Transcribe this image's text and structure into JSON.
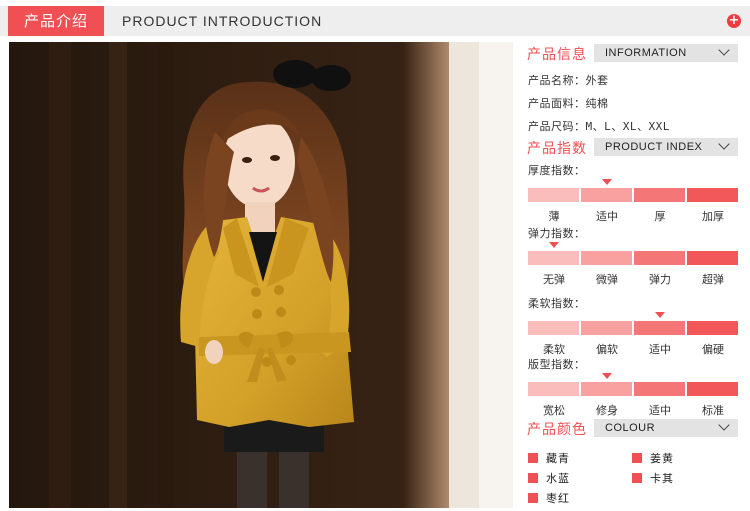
{
  "header": {
    "cn_title": "产品介绍",
    "en_title": "PRODUCT INTRODUCTION",
    "plus_icon": "plus-circle-icon"
  },
  "photo": {
    "alt": "model wearing mustard yellow double-breasted trench coat with belt"
  },
  "info": {
    "cn": "产品信息",
    "en": "INFORMATION",
    "lines": [
      {
        "label": "产品名称：",
        "value": "外套"
      },
      {
        "label": "产品面料：",
        "value": "纯棉"
      },
      {
        "label": "产品尺码：",
        "value": "M、L、XL、XXL"
      }
    ]
  },
  "index": {
    "cn": "产品指数",
    "en": "PRODUCT INDEX",
    "scale_colors": [
      "#fbbcbc",
      "#f9a0a0",
      "#f57676",
      "#f2585a"
    ],
    "arrow_color": "#f04f53",
    "rows": [
      {
        "label": "厚度指数：",
        "options": [
          "薄",
          "适中",
          "厚",
          "加厚"
        ],
        "selected": 1
      },
      {
        "label": "弹力指数：",
        "options": [
          "无弹",
          "微弹",
          "弹力",
          "超弹"
        ],
        "selected": 0
      },
      {
        "label": "柔软指数：",
        "options": [
          "柔软",
          "偏软",
          "适中",
          "偏硬"
        ],
        "selected": 2
      },
      {
        "label": "版型指数：",
        "options": [
          "宽松",
          "修身",
          "适中",
          "标准"
        ],
        "selected": 1
      }
    ]
  },
  "colour": {
    "cn": "产品颜色",
    "en": "COLOUR",
    "swatch_color": "#f04f53",
    "items": [
      "藏青",
      "姜黄",
      "水蓝",
      "卡其",
      "枣红"
    ]
  },
  "brand_accent": "#f04f53"
}
